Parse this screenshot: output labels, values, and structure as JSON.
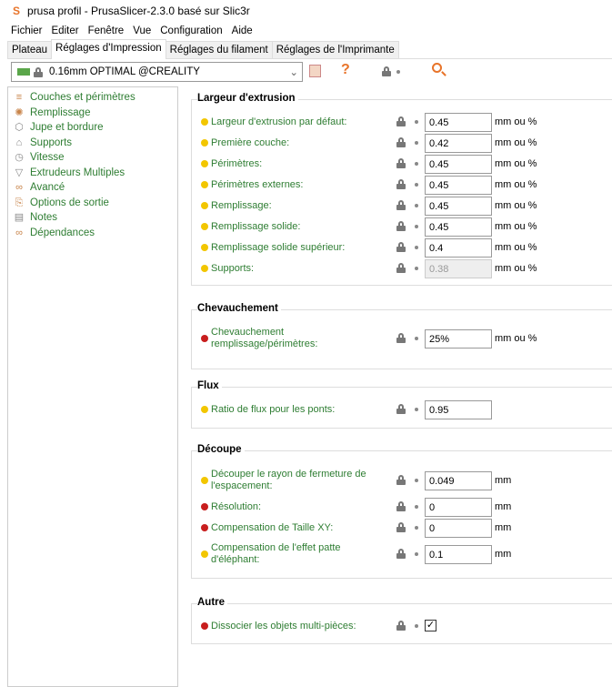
{
  "window": {
    "title": "prusa profil - PrusaSlicer-2.3.0 basé sur Slic3r"
  },
  "menu": [
    "Fichier",
    "Editer",
    "Fenêtre",
    "Vue",
    "Configuration",
    "Aide"
  ],
  "tabs": [
    "Plateau",
    "Réglages d'Impression",
    "Réglages du filament",
    "Réglages de l'Imprimante"
  ],
  "preset": {
    "value": "0.16mm OPTIMAL @CREALITY",
    "help": "?"
  },
  "sidebar": [
    {
      "label": "Couches et périmètres",
      "icon": "layers-icon"
    },
    {
      "label": "Remplissage",
      "icon": "infill-icon"
    },
    {
      "label": "Jupe et bordure",
      "icon": "skirt-icon"
    },
    {
      "label": "Supports",
      "icon": "support-icon"
    },
    {
      "label": "Vitesse",
      "icon": "clock-icon"
    },
    {
      "label": "Extrudeurs Multiples",
      "icon": "funnel-icon"
    },
    {
      "label": "Avancé",
      "icon": "wrench-icon"
    },
    {
      "label": "Options de sortie",
      "icon": "output-icon"
    },
    {
      "label": "Notes",
      "icon": "notes-icon"
    },
    {
      "label": "Dépendances",
      "icon": "wrench-icon"
    }
  ],
  "groups": {
    "largeur": {
      "title": "Largeur d'extrusion",
      "rows": [
        {
          "label": "Largeur d'extrusion par défaut:",
          "value": "0.45",
          "unit": "mm ou %"
        },
        {
          "label": "Première couche:",
          "value": "0.42",
          "unit": "mm ou %"
        },
        {
          "label": "Périmètres:",
          "value": "0.45",
          "unit": "mm ou %"
        },
        {
          "label": "Périmètres externes:",
          "value": "0.45",
          "unit": "mm ou %"
        },
        {
          "label": "Remplissage:",
          "value": "0.45",
          "unit": "mm ou %"
        },
        {
          "label": "Remplissage solide:",
          "value": "0.45",
          "unit": "mm ou %"
        },
        {
          "label": "Remplissage solide supérieur:",
          "value": "0.4",
          "unit": "mm ou %"
        },
        {
          "label": "Supports:",
          "value": "0.38",
          "unit": "mm ou %"
        }
      ]
    },
    "chev": {
      "title": "Chevauchement",
      "rows": [
        {
          "label1": "Chevauchement",
          "label2": "remplissage/périmètres:",
          "value": "25%",
          "unit": "mm ou %"
        }
      ]
    },
    "flux": {
      "title": "Flux",
      "rows": [
        {
          "label": "Ratio de flux pour les ponts:",
          "value": "0.95"
        }
      ]
    },
    "decoupe": {
      "title": "Découpe",
      "rows": [
        {
          "label1": "Découper le rayon de fermeture de",
          "label2": "l'espacement:",
          "value": "0.049",
          "unit": "mm"
        },
        {
          "label": "Résolution:",
          "value": "0",
          "unit": "mm"
        },
        {
          "label": "Compensation de Taille XY:",
          "value": "0",
          "unit": "mm"
        },
        {
          "label1": "Compensation de l'effet patte",
          "label2": "d'éléphant:",
          "value": "0.1",
          "unit": "mm"
        }
      ]
    },
    "autre": {
      "title": "Autre",
      "rows": [
        {
          "label": "Dissocier les objets multi-pièces:",
          "checked": "✓"
        }
      ]
    }
  }
}
